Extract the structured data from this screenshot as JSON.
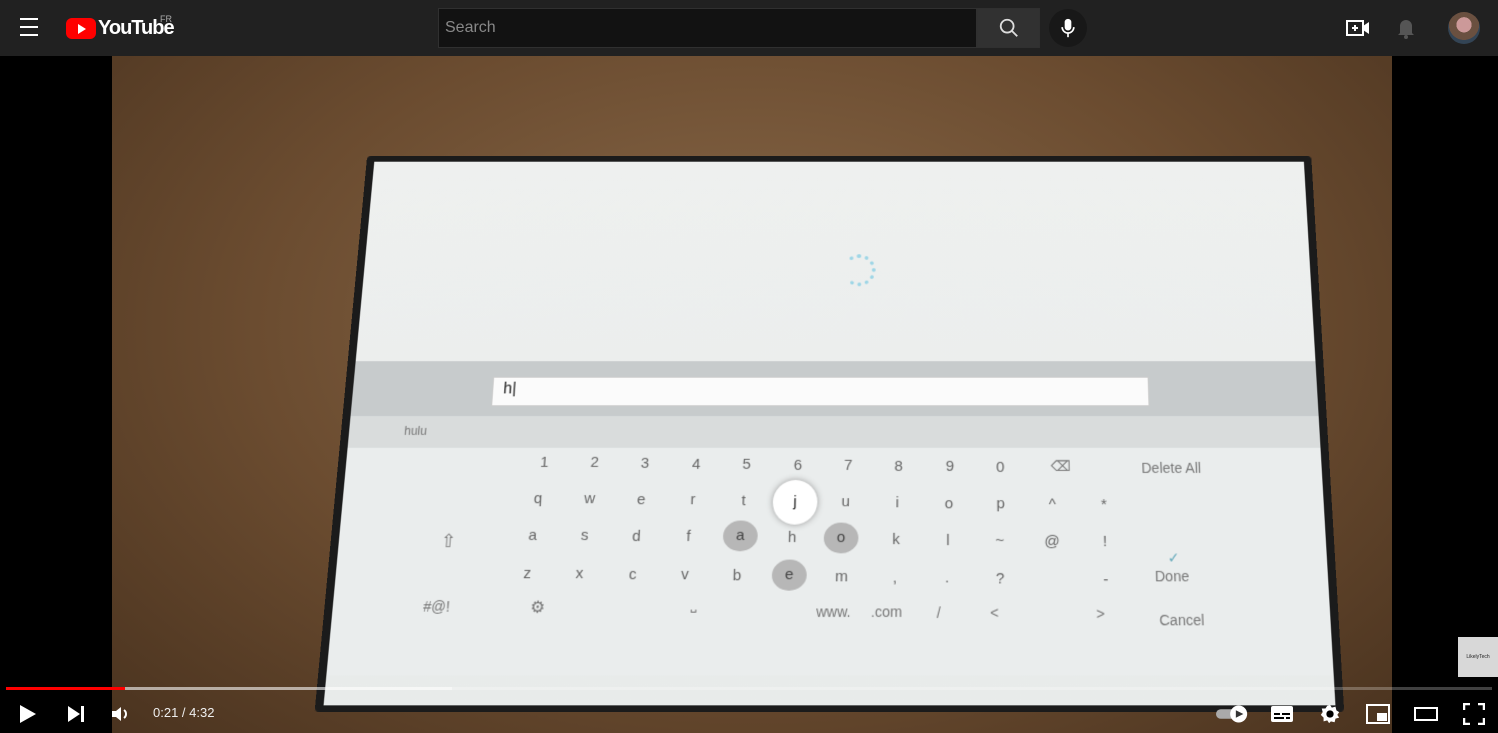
{
  "header": {
    "logo_text": "YouTube",
    "country_code": "FR",
    "search_placeholder": "Search"
  },
  "video_frame": {
    "tv_search_text": "h",
    "suggestion": "hulu",
    "keyboard": {
      "row1": [
        "1",
        "2",
        "3",
        "4",
        "5",
        "6",
        "7",
        "8",
        "9",
        "0"
      ],
      "row2": [
        "q",
        "w",
        "e",
        "r",
        "t",
        "j",
        "u",
        "i",
        "o",
        "p",
        "^",
        "*"
      ],
      "row3": [
        "a",
        "s",
        "d",
        "f",
        "a",
        "h",
        "o",
        "k",
        "l",
        "~",
        "@",
        "!"
      ],
      "row4": [
        "z",
        "x",
        "c",
        "v",
        "b",
        "e",
        "m",
        ",",
        ".",
        "?",
        "-"
      ],
      "row5": [
        "#@!",
        "www.",
        ".com",
        "/",
        "<",
        ">"
      ],
      "delete_all": "Delete All",
      "done": "Done",
      "cancel": "Cancel"
    }
  },
  "player": {
    "current_time": "0:21",
    "duration": "4:32",
    "time_display": "0:21 / 4:32",
    "progress_fraction": 0.08,
    "buffered_fraction": 0.3
  },
  "watermark_text": "LikelyTech"
}
